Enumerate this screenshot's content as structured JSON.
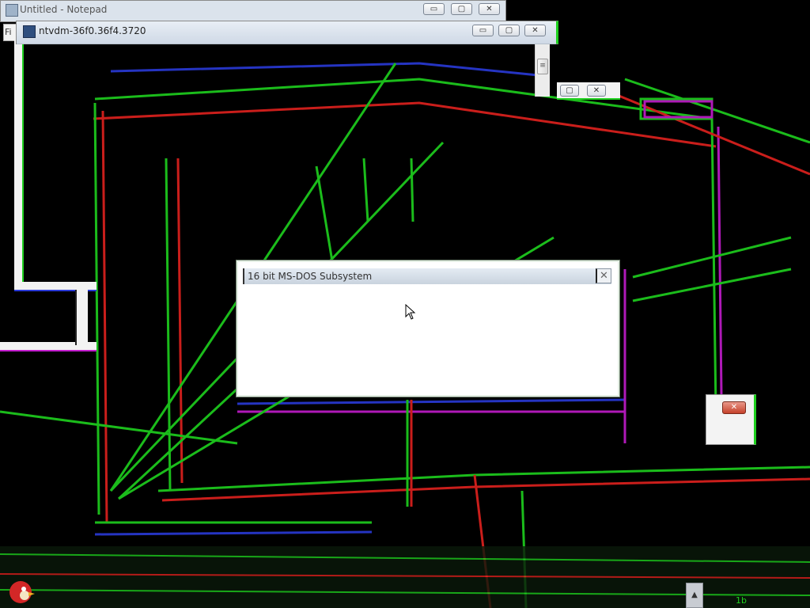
{
  "notepad_window": {
    "title": "Untitled - Notepad",
    "menu_first_letter": "Fi",
    "buttons": {
      "minimize": "▭",
      "maximize": "▢",
      "close": "✕"
    }
  },
  "ntvdm_window": {
    "title": "ntvdm-36f0.36f4.3720",
    "buttons": {
      "minimize": "▭",
      "maximize": "▢",
      "close": "✕"
    },
    "scroll_thumb_glyph": "≡"
  },
  "ghost_window": {
    "buttons": {
      "maximize": "▢",
      "close": "✕"
    }
  },
  "dialog": {
    "title": "16 bit MS-DOS Subsystem",
    "close_glyph": "✕"
  },
  "small_popup": {
    "close_glyph": "✕"
  },
  "taskbar": {
    "show_hidden_glyph": "▲",
    "tray_text": "1b"
  },
  "colors": {
    "glitch_green": "#1fd11f",
    "glitch_red": "#e0221e",
    "glitch_blue": "#2a3ad8",
    "glitch_magenta": "#c21ccd",
    "window_face": "#f3f3f3",
    "close_red": "#c5412a"
  }
}
